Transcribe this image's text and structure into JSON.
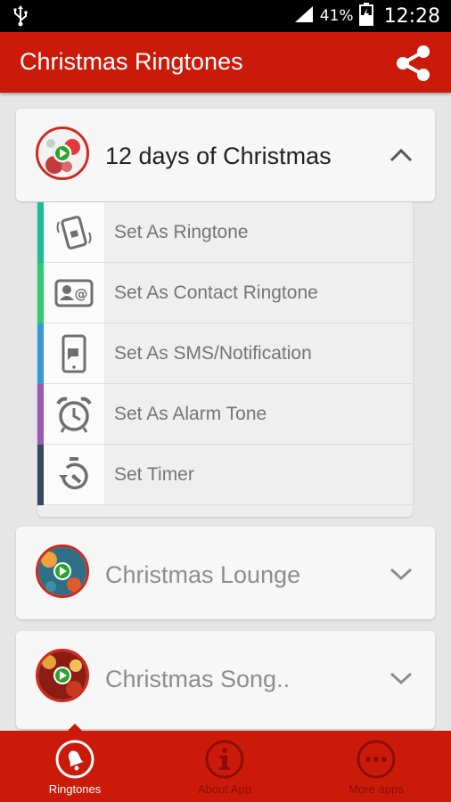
{
  "status_bar": {
    "battery": "41%",
    "time": "12:28"
  },
  "app_bar": {
    "title": "Christmas Ringtones"
  },
  "expanded_card": {
    "title": "12 days of Christmas",
    "options": [
      {
        "label": "Set As Ringtone",
        "icon": "phone-ringing-icon",
        "color": "#1abc9c"
      },
      {
        "label": "Set As Contact Ringtone",
        "icon": "contact-card-icon",
        "color": "#2ecc71"
      },
      {
        "label": "Set As SMS/Notification",
        "icon": "sms-phone-icon",
        "color": "#3498db"
      },
      {
        "label": "Set As Alarm Tone",
        "icon": "alarm-clock-icon",
        "color": "#9b59b6"
      },
      {
        "label": "Set Timer",
        "icon": "stopwatch-icon",
        "color": "#34495e"
      }
    ]
  },
  "collapsed_cards": [
    {
      "title": "Christmas Lounge"
    },
    {
      "title": "Christmas Song.."
    }
  ],
  "bottom_nav": {
    "items": [
      {
        "label": "Ringtones",
        "icon": "bell-icon",
        "active": true
      },
      {
        "label": "About App",
        "icon": "info-icon",
        "active": false
      },
      {
        "label": "More apps",
        "icon": "more-dots-icon",
        "active": false
      }
    ]
  },
  "colors": {
    "primary": "#cc1a0a",
    "inactive_nav": "#8a0e05"
  }
}
